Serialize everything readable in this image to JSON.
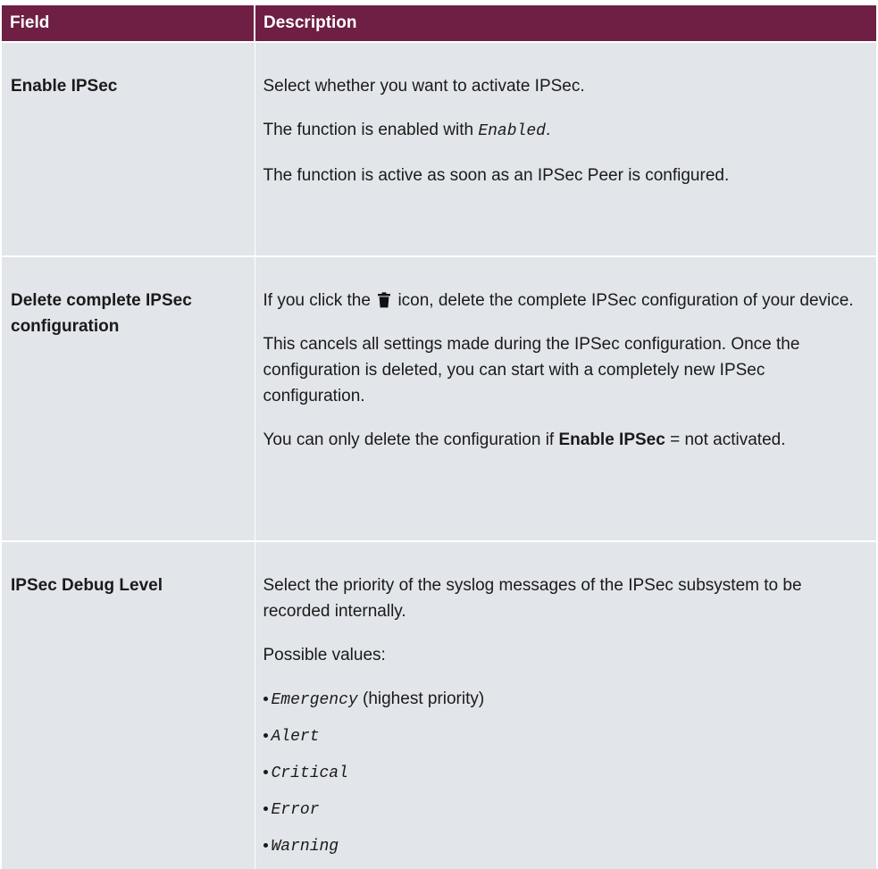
{
  "header": {
    "field": "Field",
    "description": "Description"
  },
  "rows": {
    "enable": {
      "field": "Enable IPSec",
      "p1": "Select whether you want to activate IPSec.",
      "p2_pre": "The function is enabled with ",
      "p2_code": "Enabled",
      "p2_post": ".",
      "p3": "The function is active as soon as an IPSec Peer is configured."
    },
    "delete": {
      "field_line1": "Delete complete IPSec",
      "field_line2": "configuration",
      "p1_pre": "If you click the ",
      "p1_post": " icon, delete the complete IPSec configuration of your device.",
      "icon": "trash-icon",
      "p2": "This cancels all settings made during the IPSec configuration. Once the configuration is deleted, you can start with a completely new IPSec configuration.",
      "p3_pre": "You can only delete the configuration if ",
      "p3_bold": "Enable IPSec",
      "p3_post": " = not activated."
    },
    "debug": {
      "field": "IPSec Debug Level",
      "p1": "Select the priority of the syslog messages of the IPSec subsystem to be recorded internally.",
      "p2": "Possible values:",
      "values": [
        {
          "code": "Emergency",
          "note": " (highest priority)"
        },
        {
          "code": "Alert",
          "note": ""
        },
        {
          "code": "Critical",
          "note": ""
        },
        {
          "code": "Error",
          "note": ""
        },
        {
          "code": "Warning",
          "note": ""
        }
      ]
    }
  },
  "colors": {
    "header_bg": "#6e1f43",
    "row_bg": "#e2e5e9"
  }
}
